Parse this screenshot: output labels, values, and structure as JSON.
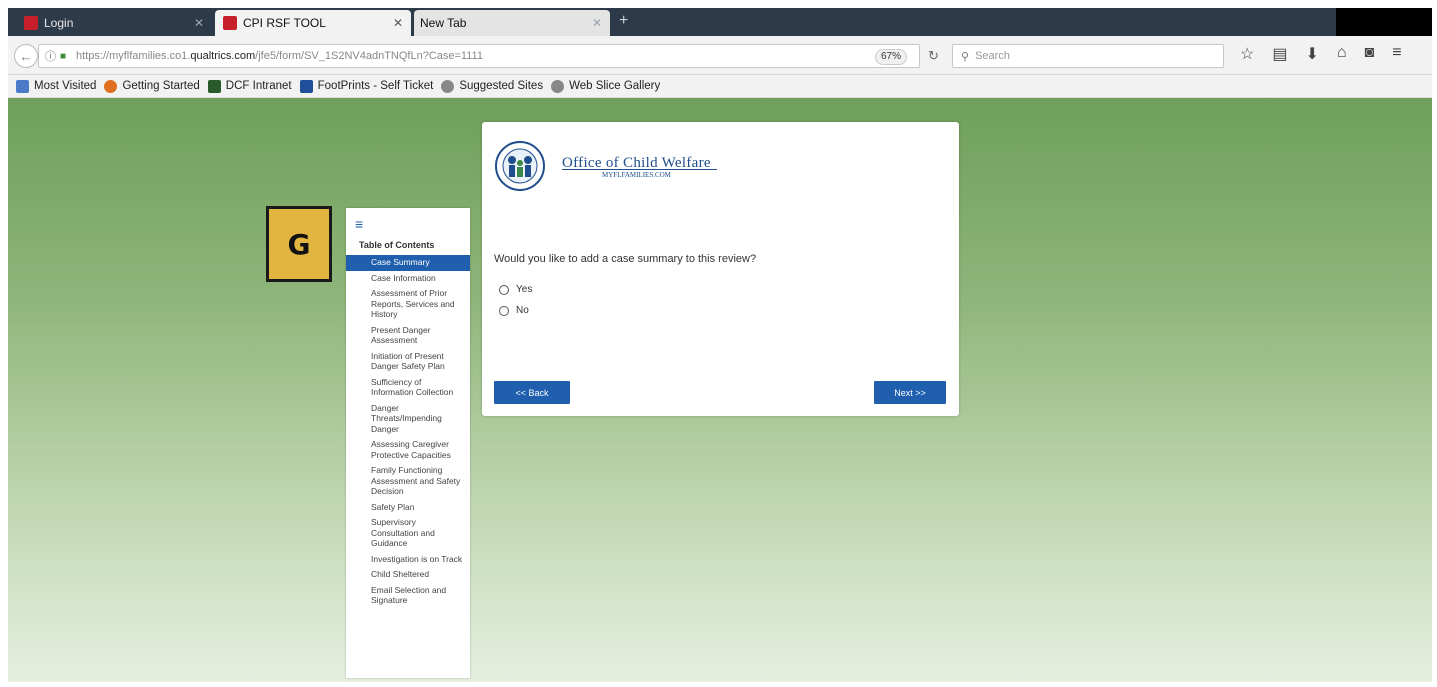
{
  "browser": {
    "tabs": [
      {
        "label": "Login",
        "active": false
      },
      {
        "label": "CPI RSF TOOL",
        "active": true
      },
      {
        "label": "New Tab",
        "active": false
      }
    ],
    "url_prefix": "https://myflfamilies.co1.",
    "url_domain": "qualtrics.com",
    "url_path": "/jfe5/form/SV_1S2NV4adnTNQfLn?Case=1111",
    "zoom": "67%",
    "search_placeholder": "Search",
    "bookmarks": [
      {
        "label": "Most Visited",
        "icon": "bookmark-folder-icon",
        "color": "#4a7ac8"
      },
      {
        "label": "Getting Started",
        "icon": "firefox-icon",
        "color": "#e07020"
      },
      {
        "label": "DCF Intranet",
        "icon": "dcf-icon",
        "color": "#2a5a2a"
      },
      {
        "label": "FootPrints - Self Ticket",
        "icon": "footprints-icon",
        "color": "#1f4f9a"
      },
      {
        "label": "Suggested Sites",
        "icon": "globe-icon",
        "color": "#888888"
      },
      {
        "label": "Web Slice Gallery",
        "icon": "globe-icon",
        "color": "#888888"
      }
    ]
  },
  "badge": {
    "letter": "G"
  },
  "toc": {
    "title": "Table of Contents",
    "items": [
      {
        "label": "Case Summary",
        "active": true
      },
      {
        "label": "Case Information",
        "active": false
      },
      {
        "label": "Assessment of Prior Reports, Services and History",
        "active": false
      },
      {
        "label": "Present Danger Assessment",
        "active": false
      },
      {
        "label": "Initiation of Present Danger Safety Plan",
        "active": false
      },
      {
        "label": "Sufficiency of Information Collection",
        "active": false
      },
      {
        "label": "Danger Threats/Impending Danger",
        "active": false
      },
      {
        "label": "Assessing Caregiver Protective Capacities",
        "active": false
      },
      {
        "label": "Family Functioning Assessment and Safety Decision",
        "active": false
      },
      {
        "label": "Safety Plan",
        "active": false
      },
      {
        "label": "Supervisory Consultation and Guidance",
        "active": false
      },
      {
        "label": "Investigation is on Track",
        "active": false
      },
      {
        "label": "Child Sheltered",
        "active": false
      },
      {
        "label": "Email Selection and Signature",
        "active": false
      }
    ]
  },
  "form": {
    "logo_title": "Office of Child Welfare",
    "logo_subtitle": "MYFLFAMILIES.COM",
    "question": "Would you like to add a case summary to this review?",
    "options": [
      "Yes",
      "No"
    ],
    "back_label": "<< Back",
    "next_label": "Next >>"
  },
  "colors": {
    "accent": "#1f5fae",
    "badge": "#e2b540",
    "page_bg_top": "#6f9f5a",
    "page_bg_bottom": "#e6efdf"
  }
}
